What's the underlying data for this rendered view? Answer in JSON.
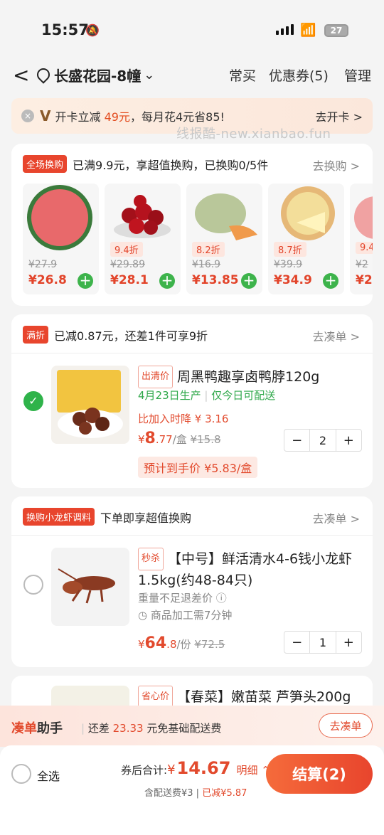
{
  "status": {
    "time": "15:57",
    "battery": "27"
  },
  "nav": {
    "back": "<",
    "location": "长盛花园-8幢",
    "chevron": "⌄",
    "frequent": "常买",
    "coupons": "优惠券(5)",
    "manage": "管理"
  },
  "promo": {
    "close": "×",
    "logo": "V",
    "text_pre": "开卡立减 ",
    "amount": "49元",
    "text_post": "，每月花4元省85!",
    "go": "去开卡 >"
  },
  "watermark": "线报酷-new.xianbao.fun",
  "exchange": {
    "tag": "全场换购",
    "text": "已满9.9元，享超值换购，已换购0/5件",
    "go": "去换购 >",
    "products": [
      {
        "disc": "",
        "old": "¥27.9",
        "price": "¥26.8"
      },
      {
        "disc": "9.4折",
        "old": "¥29.89",
        "price": "¥28.1"
      },
      {
        "disc": "8.2折",
        "old": "¥16.9",
        "price": "¥13.85"
      },
      {
        "disc": "8.7折",
        "old": "¥39.9",
        "price": "¥34.9"
      },
      {
        "disc": "9.4",
        "old": "¥2",
        "price": "¥2"
      }
    ]
  },
  "discount": {
    "tag": "满折",
    "text": "已减0.87元，还差1件可享9折",
    "go": "去凑单 >",
    "item": {
      "tag": "出清价",
      "title": "周黑鸭趣享卤鸭脖120g",
      "date": "4月23日生产",
      "sep": "|",
      "deliver": "仅今日可配送",
      "drop": "比加入时降 ¥ 3.16",
      "price_int": "8",
      "price_dec": ".77",
      "unit": "/盒",
      "old": "¥15.8",
      "est": "预计到手价 ¥5.83/盒",
      "qty": "2",
      "minus": "−",
      "plus": "+",
      "check": "✓"
    }
  },
  "crayfish": {
    "tag": "换购小龙虾调料",
    "text": "下单即享超值换购",
    "go": "去凑单 >",
    "item": {
      "tag": "秒杀",
      "title": "【中号】鲜活清水4-6钱小龙虾1.5kg(约48-84只)",
      "note1": "重量不足退差价 ⓘ",
      "note2": "◷ 商品加工需7分钟",
      "price_int": "64",
      "price_dec": ".8",
      "unit": "/份",
      "old": "¥72.5",
      "qty": "1",
      "minus": "−",
      "plus": "+"
    }
  },
  "next_item": {
    "tag": "省心价",
    "title": "【春菜】嫩苗菜 芦笋头200g"
  },
  "helper": {
    "t1a": "凑单",
    "t1b": "助手",
    "text_pre": "还差 ",
    "amount": "23.33",
    "text_post": " 元免基础配送费",
    "btn": "去凑单"
  },
  "bottom": {
    "select_all": "全选",
    "total_label": "券后合计: ",
    "currency": "¥",
    "total": "14.67",
    "detail": "明细 ⌃",
    "fee": "含配送费¥3 | ",
    "saved": "已减¥5.87",
    "pay": "结算(2)"
  }
}
